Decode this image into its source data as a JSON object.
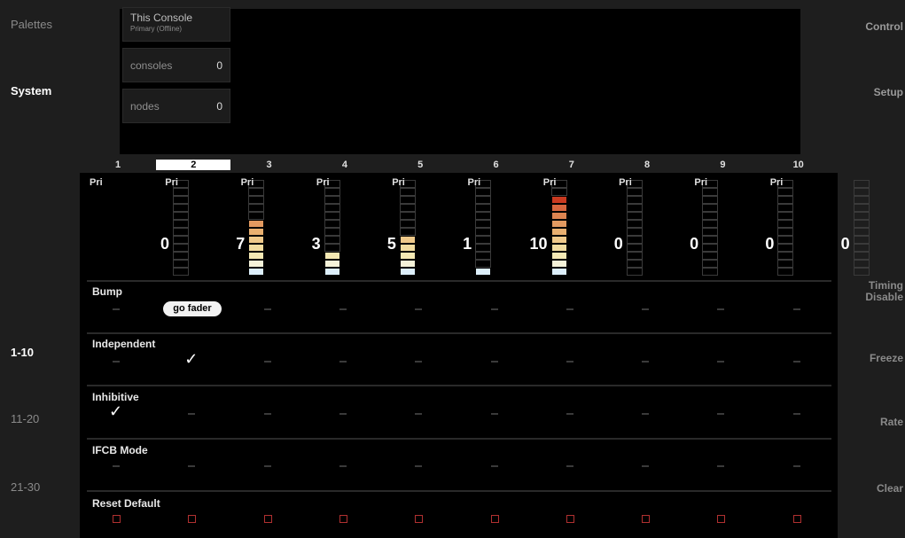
{
  "left_nav": {
    "palettes": "Palettes",
    "system": "System",
    "page_1_10": "1-10",
    "page_11_20": "11-20",
    "page_21_30": "21-30"
  },
  "right_nav": {
    "control": "Control",
    "setup": "Setup",
    "timing_line1": "Timing",
    "timing_line2": "Disable",
    "freeze": "Freeze",
    "rate": "Rate",
    "clear": "Clear"
  },
  "console": {
    "title": "This Console",
    "subtitle": "Primary (Offline)",
    "consoles_label": "consoles",
    "consoles_value": "0",
    "nodes_label": "nodes",
    "nodes_value": "0"
  },
  "faders": [
    {
      "num": "1",
      "pri": "Pri",
      "level": "0"
    },
    {
      "num": "2",
      "pri": "Pri",
      "level": "7"
    },
    {
      "num": "3",
      "pri": "Pri",
      "level": "3"
    },
    {
      "num": "4",
      "pri": "Pri",
      "level": "5"
    },
    {
      "num": "5",
      "pri": "Pri",
      "level": "1"
    },
    {
      "num": "6",
      "pri": "Pri",
      "level": "10"
    },
    {
      "num": "7",
      "pri": "Pri",
      "level": "0"
    },
    {
      "num": "8",
      "pri": "Pri",
      "level": "0"
    },
    {
      "num": "9",
      "pri": "Pri",
      "level": "0"
    },
    {
      "num": "10",
      "pri": "Pri",
      "level": "0"
    }
  ],
  "selected_fader": "2",
  "sections": {
    "bump": "Bump",
    "go_fader": "go fader",
    "independent": "Independent",
    "inhibitive": "Inhibitive",
    "ifcb": "IFCB Mode",
    "reset": "Reset Default"
  },
  "checks": {
    "independent": "2",
    "inhibitive": "1"
  },
  "check_glyph": "✓",
  "meter_colors": [
    "#dceefa",
    "#f5f3d9",
    "#f5e9b4",
    "#f2dca0",
    "#efc98a",
    "#e9b070",
    "#e39a60",
    "#dd8450",
    "#d6663e",
    "#c93a20"
  ],
  "colors": {
    "accent_red": "#b03030",
    "background": "#000000"
  }
}
